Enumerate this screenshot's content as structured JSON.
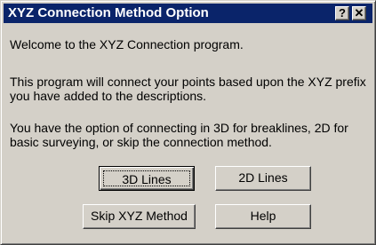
{
  "window": {
    "title": "XYZ Connection Method Option",
    "help_glyph": "?",
    "close_glyph": "✕"
  },
  "content": {
    "welcome": "Welcome to the XYZ Connection program.",
    "paragraph1": "This program will connect your points based upon the XYZ prefix you have added to the descriptions.",
    "paragraph2": "You have the option of connecting in 3D for breaklines, 2D for basic surveying, or skip the connection method."
  },
  "buttons": {
    "lines_3d": "3D Lines",
    "lines_2d": "2D Lines",
    "skip": "Skip XYZ Method",
    "help": "Help"
  },
  "colors": {
    "titlebar": "#0a246a",
    "face": "#d4d0c8"
  },
  "icons": {
    "help": "question-mark-icon",
    "close": "close-icon"
  }
}
